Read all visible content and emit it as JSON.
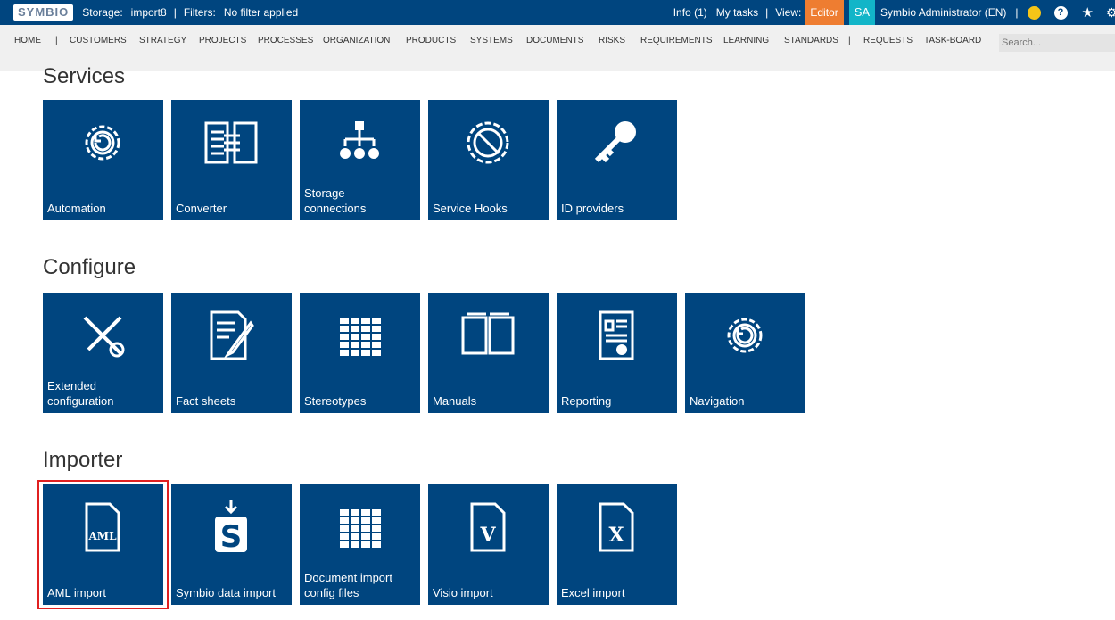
{
  "topbar": {
    "logo": "SYMBIO",
    "storage_label": "Storage:",
    "storage": "import8",
    "filters_label": "Filters:",
    "filters": "No filter applied",
    "info": "Info (1)",
    "my_tasks": "My tasks",
    "view_label": "View:",
    "view": "Editor",
    "avatar": "SA",
    "user": "Symbio Administrator (EN)"
  },
  "nav": {
    "items": [
      "HOME",
      "|",
      "CUSTOMERS",
      "STRATEGY",
      "PROJECTS",
      "PROCESSES",
      "ORGANIZATION",
      "PRODUCTS",
      "SYSTEMS",
      "DOCUMENTS",
      "RISKS",
      "REQUIREMENTS",
      "LEARNING",
      "STANDARDS",
      "|",
      "REQUESTS",
      "TASK-BOARD"
    ],
    "search_placeholder": "Search..."
  },
  "sections": [
    {
      "title": "Services",
      "tiles": [
        {
          "label": "Automation",
          "icon": "gear-cycle"
        },
        {
          "label": "Converter",
          "icon": "converter"
        },
        {
          "label": "Storage connections",
          "icon": "hierarchy"
        },
        {
          "label": "Service Hooks",
          "icon": "gear-wrench"
        },
        {
          "label": "ID providers",
          "icon": "key"
        }
      ]
    },
    {
      "title": "Configure",
      "tiles": [
        {
          "label": "Extended configuration",
          "icon": "tools"
        },
        {
          "label": "Fact sheets",
          "icon": "document-pencil"
        },
        {
          "label": "Stereotypes",
          "icon": "grid"
        },
        {
          "label": "Manuals",
          "icon": "book"
        },
        {
          "label": "Reporting",
          "icon": "report"
        },
        {
          "label": "Navigation",
          "icon": "gear-cycle"
        }
      ]
    },
    {
      "title": "Importer",
      "tiles": [
        {
          "label": "AML import",
          "icon": "aml-file"
        },
        {
          "label": "Symbio data import",
          "icon": "symbio-import"
        },
        {
          "label": "Document import config files",
          "icon": "grid"
        },
        {
          "label": "Visio import",
          "icon": "visio-file"
        },
        {
          "label": "Excel import",
          "icon": "excel-file"
        }
      ]
    }
  ],
  "selected_tile": "AML import",
  "colors": {
    "topbar": "#00457f",
    "tile": "#00457f",
    "editor": "#ee7d31",
    "avatar": "#12b5c8",
    "selection": "#e02020"
  }
}
